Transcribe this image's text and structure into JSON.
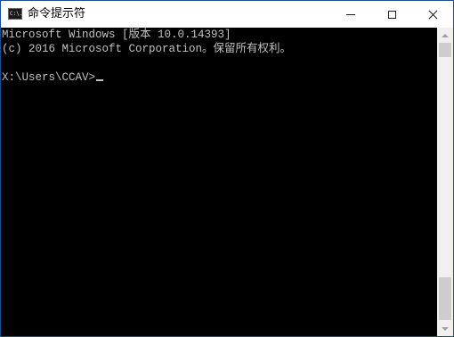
{
  "window": {
    "title": "命令提示符",
    "icon": "cmd-console-icon",
    "icon_text": "C:\\."
  },
  "caption_buttons": {
    "minimize": "minimize-icon",
    "maximize": "maximize-icon",
    "close": "close-icon"
  },
  "console": {
    "lines": [
      "Microsoft Windows [版本 10.0.14393]",
      "(c) 2016 Microsoft Corporation。保留所有权利。",
      "",
      "X:\\Users\\CCAV>"
    ],
    "text_color": "#c0c0c0",
    "background": "#000000"
  }
}
